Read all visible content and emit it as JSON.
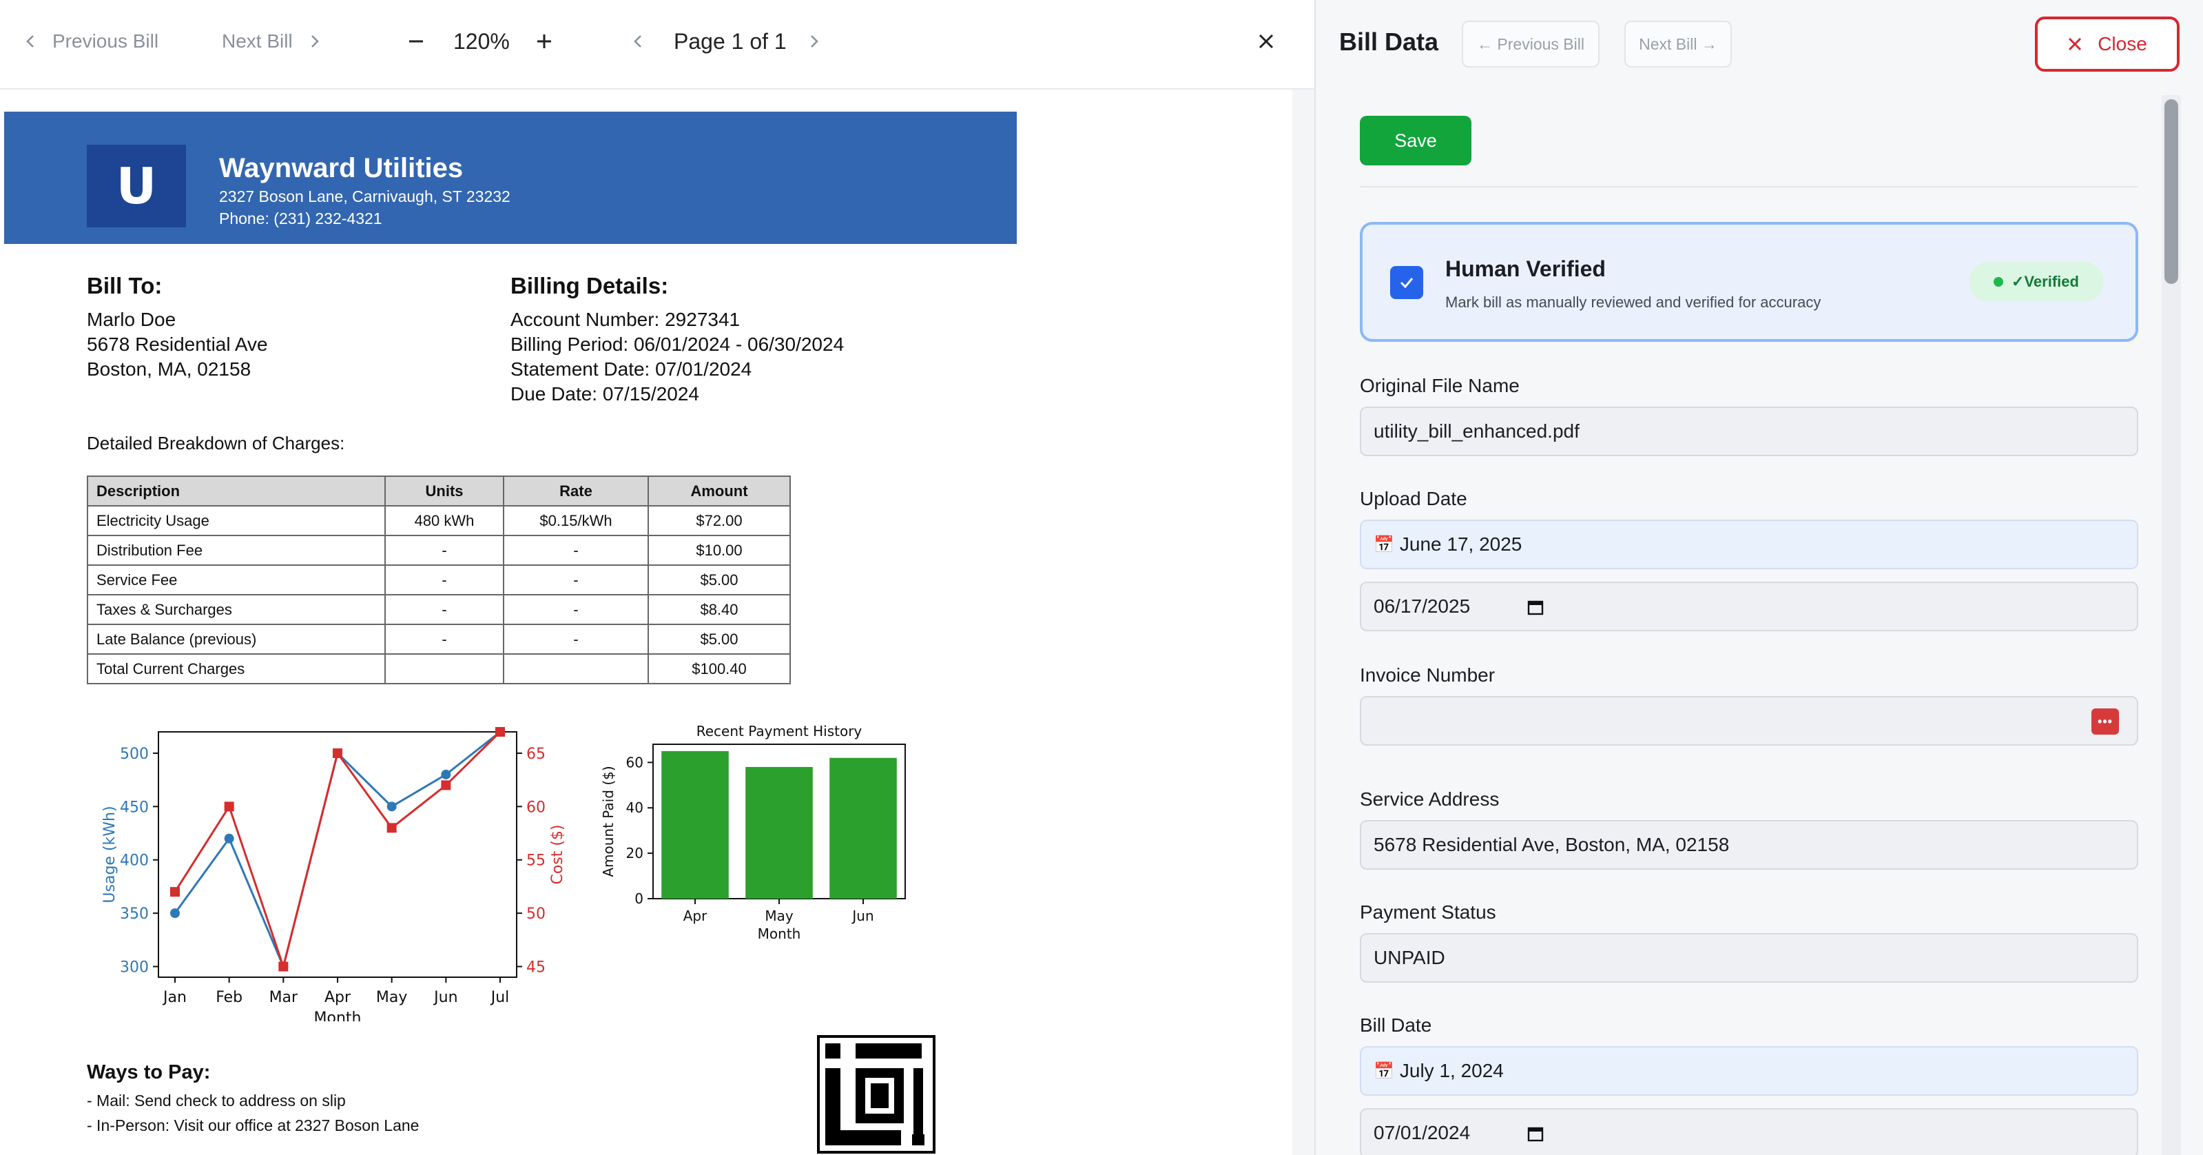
{
  "toolbar": {
    "prev_bill": "Previous Bill",
    "next_bill": "Next Bill",
    "zoom": "120%",
    "page": "Page 1 of 1"
  },
  "doc": {
    "logo_letter": "U",
    "company": "Waynward Utilities",
    "address": "2327 Boson Lane, Carnivaugh, ST 23232",
    "phone": "Phone: (231) 232-4321",
    "bill_to_heading": "Bill To:",
    "bill_to": [
      "Marlo Doe",
      "5678 Residential Ave",
      "Boston, MA, 02158"
    ],
    "billing_heading": "Billing Details:",
    "billing": [
      "Account Number: 2927341",
      "Billing Period: 06/01/2024 - 06/30/2024",
      "Statement Date: 07/01/2024",
      "Due Date: 07/15/2024"
    ],
    "breakdown_label": "Detailed Breakdown of Charges:",
    "table_headers": [
      "Description",
      "Units",
      "Rate",
      "Amount"
    ],
    "table_rows": [
      [
        "Electricity Usage",
        "480 kWh",
        "$0.15/kWh",
        "$72.00"
      ],
      [
        "Distribution Fee",
        "-",
        "-",
        "$10.00"
      ],
      [
        "Service Fee",
        "-",
        "-",
        "$5.00"
      ],
      [
        "Taxes & Surcharges",
        "-",
        "-",
        "$8.40"
      ],
      [
        "Late Balance (previous)",
        "-",
        "-",
        "$5.00"
      ],
      [
        "Total Current Charges",
        "",
        "",
        "$100.40"
      ]
    ],
    "ways_heading": "Ways to Pay:",
    "ways": [
      "- Mail: Send check to address on slip",
      "- In-Person: Visit our office at 2327 Boson Lane"
    ]
  },
  "chart_data": [
    {
      "type": "line",
      "title": "",
      "xlabel": "Month",
      "categories": [
        "Jan",
        "Feb",
        "Mar",
        "Apr",
        "May",
        "Jun",
        "Jul"
      ],
      "ylabel": "Usage (kWh)",
      "ylabel_right": "Cost ($)",
      "ylim": [
        290,
        520
      ],
      "ylim_right": [
        44,
        67
      ],
      "yticks": [
        300,
        350,
        400,
        450,
        500
      ],
      "yticks_right": [
        45,
        50,
        55,
        60,
        65
      ],
      "grid": false,
      "series": [
        {
          "name": "Usage (kWh)",
          "axis": "left",
          "color": "#2e78b7",
          "marker": "circle",
          "values": [
            350,
            420,
            300,
            500,
            450,
            480,
            520
          ]
        },
        {
          "name": "Cost ($)",
          "axis": "right",
          "color": "#d62d2d",
          "marker": "square",
          "values": [
            52,
            60,
            45,
            65,
            58,
            62,
            67
          ]
        }
      ]
    },
    {
      "type": "bar",
      "title": "Recent Payment History",
      "xlabel": "Month",
      "ylabel": "Amount Paid ($)",
      "categories": [
        "Apr",
        "May",
        "Jun"
      ],
      "values": [
        65,
        58,
        62
      ],
      "ylim": [
        0,
        68
      ],
      "yticks": [
        0,
        20,
        40,
        60
      ],
      "color": "#2ca02c"
    }
  ],
  "panel": {
    "title": "Bill Data",
    "prev_btn": "← Previous Bill",
    "next_btn": "Next Bill →",
    "close_btn": "Close",
    "save_btn": "Save",
    "hv_title": "Human Verified",
    "hv_sub": "Mark bill as manually reviewed and verified for accuracy",
    "hv_badge": "✓Verified",
    "fields": {
      "file_name_label": "Original File Name",
      "file_name_value": "utility_bill_enhanced.pdf",
      "upload_label": "Upload Date",
      "upload_display": "June 17, 2025",
      "upload_input": "06/17/2025",
      "invoice_label": "Invoice Number",
      "invoice_value": "",
      "address_label": "Service Address",
      "address_value": "5678 Residential Ave, Boston, MA, 02158",
      "status_label": "Payment Status",
      "status_value": "UNPAID",
      "bill_date_label": "Bill Date",
      "bill_date_display": "July 1, 2024",
      "bill_date_input": "07/01/2024"
    }
  },
  "colors": {
    "banner": "#3366b0",
    "save": "#12a53c",
    "close": "#d8262f",
    "checkbox": "#2563eb"
  }
}
